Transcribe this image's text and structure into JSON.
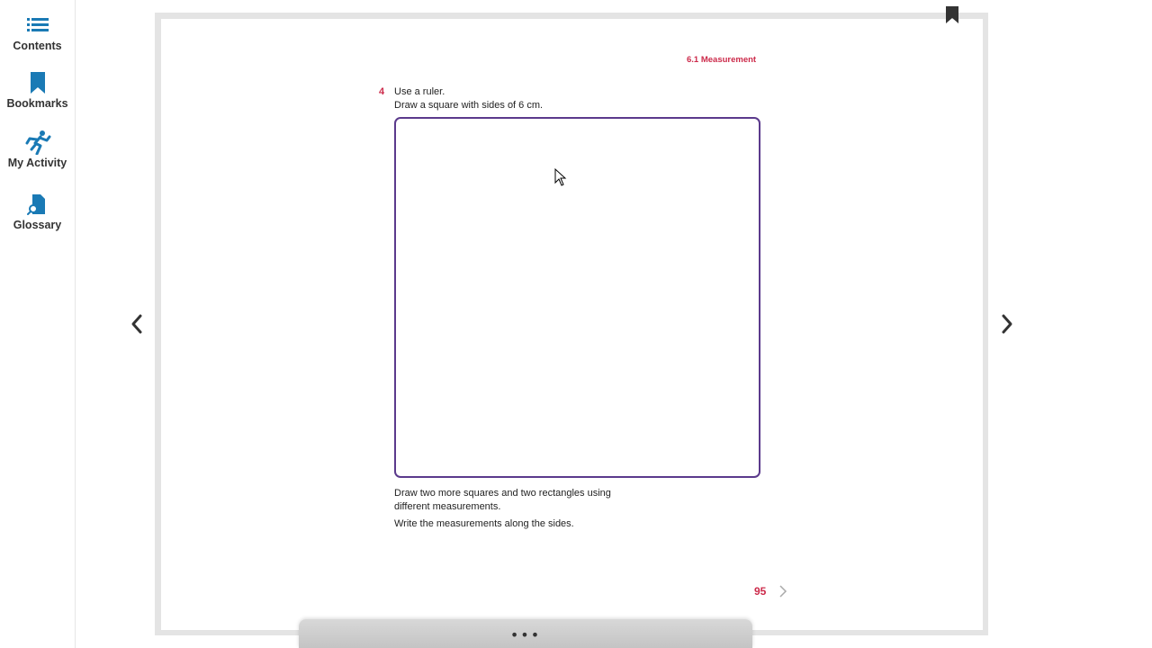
{
  "sidebar": {
    "items": [
      {
        "label": "Contents",
        "icon": "list-icon"
      },
      {
        "label": "Bookmarks",
        "icon": "bookmark-icon"
      },
      {
        "label": "My Activity",
        "icon": "activity-runner-icon"
      },
      {
        "label": "Glossary",
        "icon": "glossary-search-icon"
      }
    ]
  },
  "colors": {
    "accent": "#1a7ab5",
    "section": "#cc2a4a",
    "box_border": "#5b3a8c"
  },
  "page": {
    "section_header": "6.1 Measurement",
    "question_number": "4",
    "instruction_1": "Use a ruler.",
    "instruction_2": "Draw a square with sides of 6 cm.",
    "followup_1": "Draw two more squares and two rectangles using",
    "followup_2": "different measurements.",
    "followup_3": "Write the measurements along the sides.",
    "page_number": "95"
  },
  "bottom_bar": {
    "dots": "•••"
  }
}
